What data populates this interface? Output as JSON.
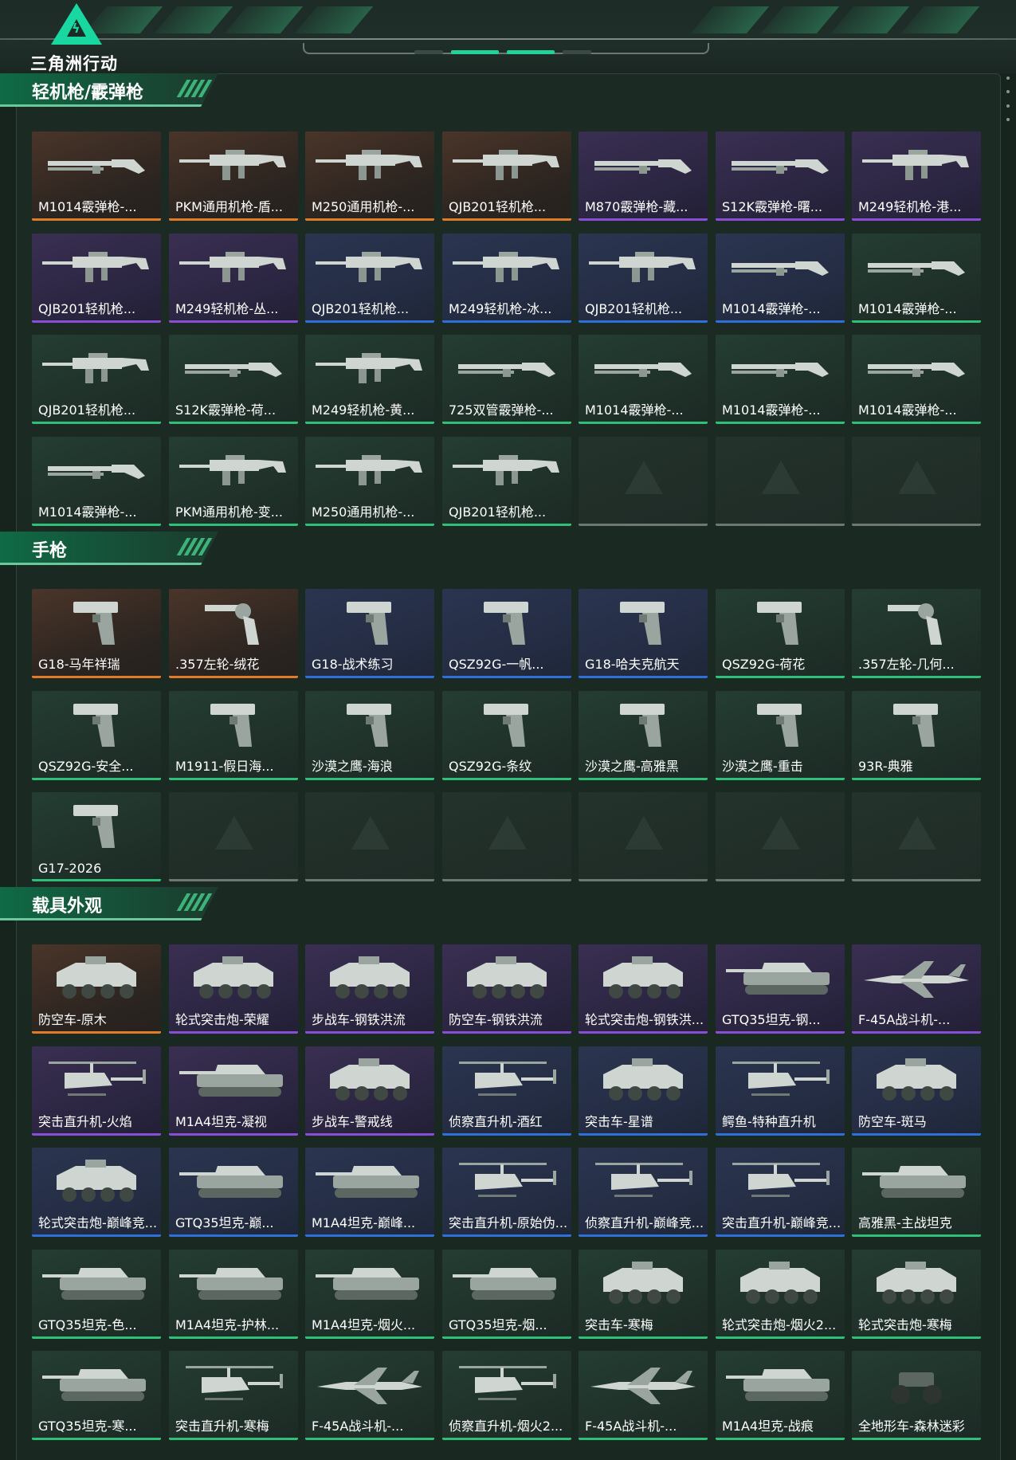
{
  "app": {
    "title": "三角洲行动"
  },
  "colors": {
    "accent": "#19d7a0",
    "rarity_orange": "#e07b2a",
    "rarity_purple": "#8a4dd6",
    "rarity_blue": "#2f6fd8",
    "rarity_green": "#2fbf78",
    "rarity_empty": "#6d7873"
  },
  "sections": [
    {
      "title": "轻机枪/霰弹枪",
      "items": [
        {
          "name": "M1014霰弹枪-...",
          "rarity": "orange",
          "icon": "shotgun-icon"
        },
        {
          "name": "PKM通用机枪-盾...",
          "rarity": "orange",
          "icon": "machine-gun-icon"
        },
        {
          "name": "M250通用机枪-...",
          "rarity": "orange",
          "icon": "machine-gun-icon"
        },
        {
          "name": "QJB201轻机枪...",
          "rarity": "orange",
          "icon": "machine-gun-icon"
        },
        {
          "name": "M870霰弹枪-藏...",
          "rarity": "purple",
          "icon": "shotgun-icon"
        },
        {
          "name": "S12K霰弹枪-曙...",
          "rarity": "purple",
          "icon": "shotgun-icon"
        },
        {
          "name": "M249轻机枪-港...",
          "rarity": "purple",
          "icon": "machine-gun-icon"
        },
        {
          "name": "QJB201轻机枪...",
          "rarity": "purple",
          "icon": "machine-gun-icon"
        },
        {
          "name": "M249轻机枪-丛...",
          "rarity": "purple",
          "icon": "machine-gun-icon"
        },
        {
          "name": "QJB201轻机枪...",
          "rarity": "blue",
          "icon": "machine-gun-icon"
        },
        {
          "name": "M249轻机枪-冰...",
          "rarity": "blue",
          "icon": "machine-gun-icon"
        },
        {
          "name": "QJB201轻机枪...",
          "rarity": "blue",
          "icon": "machine-gun-icon"
        },
        {
          "name": "M1014霰弹枪-...",
          "rarity": "blue",
          "icon": "shotgun-icon"
        },
        {
          "name": "M1014霰弹枪-...",
          "rarity": "green",
          "icon": "shotgun-icon"
        },
        {
          "name": "QJB201轻机枪...",
          "rarity": "green",
          "icon": "machine-gun-icon"
        },
        {
          "name": "S12K霰弹枪-荷...",
          "rarity": "green",
          "icon": "shotgun-icon"
        },
        {
          "name": "M249轻机枪-黄...",
          "rarity": "green",
          "icon": "machine-gun-icon"
        },
        {
          "name": "725双管霰弹枪-...",
          "rarity": "green",
          "icon": "shotgun-icon"
        },
        {
          "name": "M1014霰弹枪-...",
          "rarity": "green",
          "icon": "shotgun-icon"
        },
        {
          "name": "M1014霰弹枪-...",
          "rarity": "green",
          "icon": "shotgun-icon"
        },
        {
          "name": "M1014霰弹枪-...",
          "rarity": "green",
          "icon": "shotgun-icon"
        },
        {
          "name": "M1014霰弹枪-...",
          "rarity": "green",
          "icon": "shotgun-icon"
        },
        {
          "name": "PKM通用机枪-变...",
          "rarity": "green",
          "icon": "machine-gun-icon"
        },
        {
          "name": "M250通用机枪-...",
          "rarity": "green",
          "icon": "machine-gun-icon"
        },
        {
          "name": "QJB201轻机枪...",
          "rarity": "green",
          "icon": "machine-gun-icon"
        },
        {
          "name": "",
          "rarity": "empty",
          "icon": "placeholder-icon"
        },
        {
          "name": "",
          "rarity": "empty",
          "icon": "placeholder-icon"
        },
        {
          "name": "",
          "rarity": "empty",
          "icon": "placeholder-icon"
        }
      ]
    },
    {
      "title": "手枪",
      "items": [
        {
          "name": "G18-马年祥瑞",
          "rarity": "orange",
          "icon": "pistol-icon"
        },
        {
          "name": ".357左轮-绒花",
          "rarity": "orange",
          "icon": "revolver-icon"
        },
        {
          "name": "G18-战术练习",
          "rarity": "blue",
          "icon": "pistol-icon"
        },
        {
          "name": "QSZ92G-一帆...",
          "rarity": "blue",
          "icon": "pistol-icon"
        },
        {
          "name": "G18-哈夫克航天",
          "rarity": "blue",
          "icon": "pistol-icon"
        },
        {
          "name": "QSZ92G-荷花",
          "rarity": "green",
          "icon": "pistol-icon"
        },
        {
          "name": ".357左轮-几何...",
          "rarity": "green",
          "icon": "revolver-icon"
        },
        {
          "name": "QSZ92G-安全...",
          "rarity": "green",
          "icon": "pistol-icon"
        },
        {
          "name": "M1911-假日海...",
          "rarity": "green",
          "icon": "pistol-icon"
        },
        {
          "name": "沙漠之鹰-海浪",
          "rarity": "green",
          "icon": "pistol-icon"
        },
        {
          "name": "QSZ92G-条纹",
          "rarity": "green",
          "icon": "pistol-icon"
        },
        {
          "name": "沙漠之鹰-高雅黑",
          "rarity": "green",
          "icon": "pistol-icon"
        },
        {
          "name": "沙漠之鹰-重击",
          "rarity": "green",
          "icon": "pistol-icon"
        },
        {
          "name": "93R-典雅",
          "rarity": "green",
          "icon": "pistol-icon"
        },
        {
          "name": "G17-2026",
          "rarity": "green",
          "icon": "pistol-icon"
        },
        {
          "name": "",
          "rarity": "empty",
          "icon": "placeholder-icon"
        },
        {
          "name": "",
          "rarity": "empty",
          "icon": "placeholder-icon"
        },
        {
          "name": "",
          "rarity": "empty",
          "icon": "placeholder-icon"
        },
        {
          "name": "",
          "rarity": "empty",
          "icon": "placeholder-icon"
        },
        {
          "name": "",
          "rarity": "empty",
          "icon": "placeholder-icon"
        },
        {
          "name": "",
          "rarity": "empty",
          "icon": "placeholder-icon"
        }
      ]
    },
    {
      "title": "载具外观",
      "items": [
        {
          "name": "防空车-原木",
          "rarity": "orange",
          "icon": "armored-vehicle-icon"
        },
        {
          "name": "轮式突击炮-荣耀",
          "rarity": "purple",
          "icon": "armored-vehicle-icon"
        },
        {
          "name": "步战车-钢铁洪流",
          "rarity": "purple",
          "icon": "armored-vehicle-icon"
        },
        {
          "name": "防空车-钢铁洪流",
          "rarity": "purple",
          "icon": "armored-vehicle-icon"
        },
        {
          "name": "轮式突击炮-钢铁洪...",
          "rarity": "purple",
          "icon": "armored-vehicle-icon"
        },
        {
          "name": "GTQ35坦克-钢...",
          "rarity": "purple",
          "icon": "tank-icon"
        },
        {
          "name": "F-45A战斗机-...",
          "rarity": "purple",
          "icon": "jet-icon"
        },
        {
          "name": "突击直升机-火焰",
          "rarity": "purple",
          "icon": "helicopter-icon"
        },
        {
          "name": "M1A4坦克-凝视",
          "rarity": "purple",
          "icon": "tank-icon"
        },
        {
          "name": "步战车-警戒线",
          "rarity": "purple",
          "icon": "armored-vehicle-icon"
        },
        {
          "name": "侦察直升机-酒红",
          "rarity": "blue",
          "icon": "helicopter-icon"
        },
        {
          "name": "突击车-星谱",
          "rarity": "blue",
          "icon": "armored-vehicle-icon"
        },
        {
          "name": "鳄鱼-特种直升机",
          "rarity": "blue",
          "icon": "helicopter-icon"
        },
        {
          "name": "防空车-斑马",
          "rarity": "blue",
          "icon": "armored-vehicle-icon"
        },
        {
          "name": "轮式突击炮-巅峰竞...",
          "rarity": "blue",
          "icon": "armored-vehicle-icon"
        },
        {
          "name": "GTQ35坦克-巅...",
          "rarity": "blue",
          "icon": "tank-icon"
        },
        {
          "name": "M1A4坦克-巅峰...",
          "rarity": "blue",
          "icon": "tank-icon"
        },
        {
          "name": "突击直升机-原始伪...",
          "rarity": "blue",
          "icon": "helicopter-icon"
        },
        {
          "name": "侦察直升机-巅峰竞...",
          "rarity": "blue",
          "icon": "helicopter-icon"
        },
        {
          "name": "突击直升机-巅峰竞...",
          "rarity": "blue",
          "icon": "helicopter-icon"
        },
        {
          "name": "高雅黑-主战坦克",
          "rarity": "green",
          "icon": "tank-icon"
        },
        {
          "name": "GTQ35坦克-色...",
          "rarity": "green",
          "icon": "tank-icon"
        },
        {
          "name": "M1A4坦克-护林...",
          "rarity": "green",
          "icon": "tank-icon"
        },
        {
          "name": "M1A4坦克-烟火...",
          "rarity": "green",
          "icon": "tank-icon"
        },
        {
          "name": "GTQ35坦克-烟...",
          "rarity": "green",
          "icon": "tank-icon"
        },
        {
          "name": "突击车-寒梅",
          "rarity": "green",
          "icon": "armored-vehicle-icon"
        },
        {
          "name": "轮式突击炮-烟火2...",
          "rarity": "green",
          "icon": "armored-vehicle-icon"
        },
        {
          "name": "轮式突击炮-寒梅",
          "rarity": "green",
          "icon": "armored-vehicle-icon"
        },
        {
          "name": "GTQ35坦克-寒...",
          "rarity": "green",
          "icon": "tank-icon"
        },
        {
          "name": "突击直升机-寒梅",
          "rarity": "green",
          "icon": "helicopter-icon"
        },
        {
          "name": "F-45A战斗机-...",
          "rarity": "green",
          "icon": "jet-icon"
        },
        {
          "name": "侦察直升机-烟火2...",
          "rarity": "green",
          "icon": "helicopter-icon"
        },
        {
          "name": "F-45A战斗机-...",
          "rarity": "green",
          "icon": "jet-icon"
        },
        {
          "name": "M1A4坦克-战痕",
          "rarity": "green",
          "icon": "tank-icon"
        },
        {
          "name": "全地形车-森林迷彩",
          "rarity": "green",
          "icon": "atv-icon"
        }
      ]
    }
  ]
}
